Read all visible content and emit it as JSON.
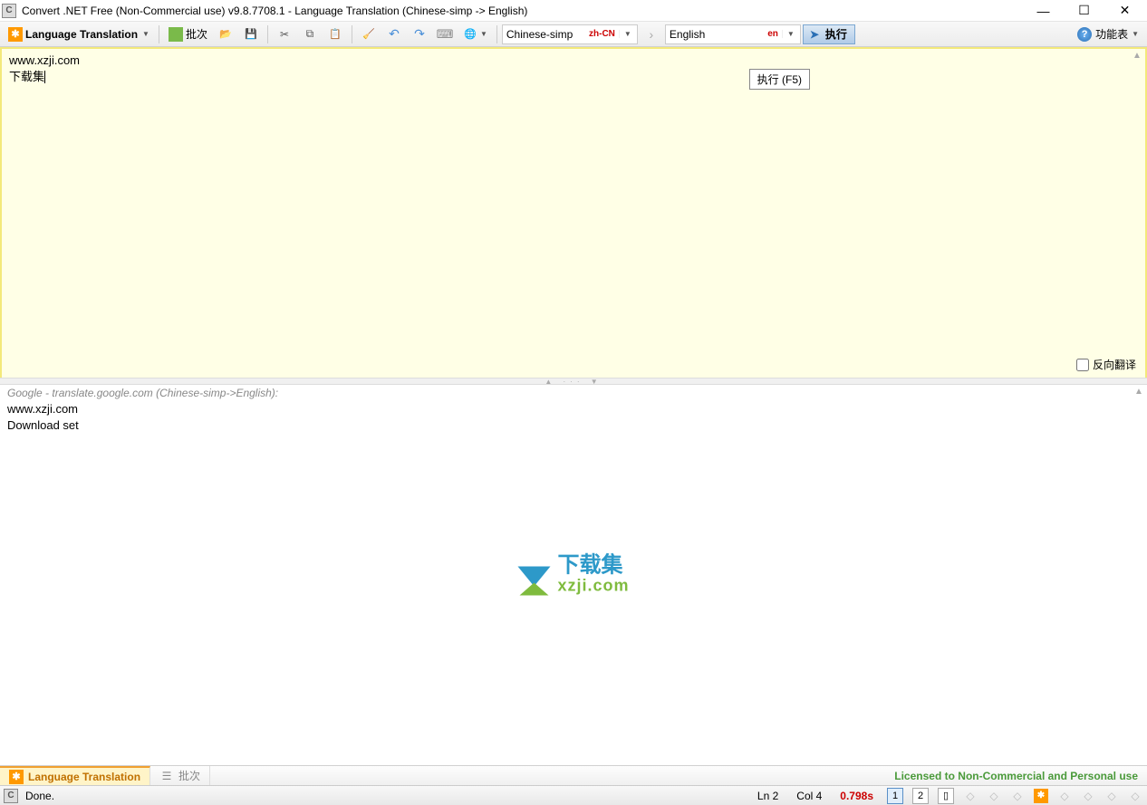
{
  "title_bar": {
    "title": "Convert .NET Free (Non-Commercial use) v9.8.7708.1 - Language Translation (Chinese-simp -> English)"
  },
  "toolbar": {
    "mode_label": "Language Translation",
    "batch_label": "批次",
    "source_lang": {
      "name": "Chinese-simp",
      "code": "zh-CN"
    },
    "target_lang": {
      "name": "English",
      "code": "en"
    },
    "execute_label": "执行",
    "menu_label": "功能表"
  },
  "input_pane": {
    "line1": "www.xzji.com",
    "line2": "下载集",
    "reverse_label": "反向翻译",
    "tooltip": "执行 (F5)"
  },
  "output_pane": {
    "header": "Google - translate.google.com (Chinese-simp->English):",
    "line1": "www.xzji.com",
    "line2": "Download set"
  },
  "watermark": {
    "cn": "下载集",
    "dom": "xzji.com"
  },
  "task_tabs": {
    "active": "Language Translation",
    "inactive": "批次",
    "license": "Licensed to Non-Commercial and Personal use"
  },
  "status_bar": {
    "done": "Done.",
    "line": "Ln 2",
    "col": "Col 4",
    "timing": "0.798s",
    "view1": "1",
    "view2": "2"
  }
}
